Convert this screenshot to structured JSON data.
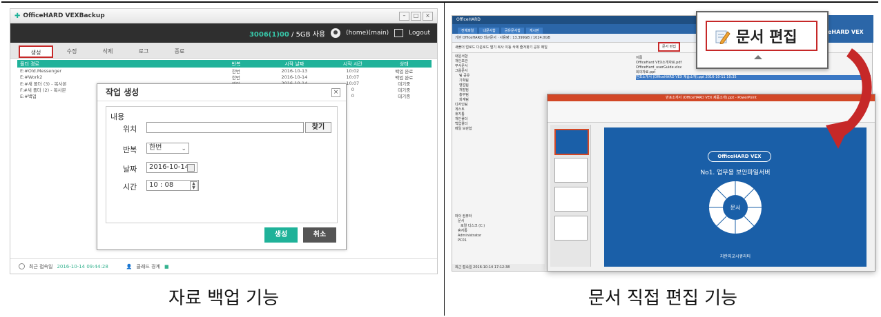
{
  "captions": {
    "left": "자료 백업 기능",
    "right": "문서 직접 편집 기능"
  },
  "left_app": {
    "title": "OfficeHARD VEXBackup",
    "window_buttons": [
      "–",
      "□",
      "×"
    ],
    "header": {
      "usage_used": "3006(1)00",
      "usage_total": "/ 5GB 사용",
      "user": "(home)(main)",
      "logout": "Logout"
    },
    "tabs": [
      {
        "label": "생성",
        "active": true
      },
      {
        "label": "수정",
        "active": false
      },
      {
        "label": "삭제",
        "active": false
      },
      {
        "label": "로그",
        "active": false
      },
      {
        "label": "종료",
        "active": false
      }
    ],
    "grid": {
      "headers": [
        "폴더 경로",
        "반복",
        "시작 날짜",
        "시작 시간",
        "상태"
      ],
      "rows": [
        [
          "E:#Old.Messenger",
          "한번",
          "2016-10-13",
          "10:02",
          "백업 완료"
        ],
        [
          "E:#Work2",
          "한번",
          "2016-10-14",
          "10:07",
          "백업 완료"
        ],
        [
          "E:#새 폴더 (3) - 복사본",
          "매일",
          "2016-10-14",
          "10:07",
          "대기중"
        ],
        [
          "F:#새 폴더 (2) - 복사본",
          "",
          "",
          "0",
          "대기중"
        ],
        [
          "E:#백업",
          "",
          "",
          "0",
          "대기중"
        ]
      ]
    },
    "dialog": {
      "title": "작업 생성",
      "close": "×",
      "section": "내용",
      "location_label": "위치",
      "location_value": "",
      "find_button": "찾기",
      "repeat_label": "반복",
      "repeat_value": "한번",
      "date_label": "날짜",
      "date_value": "2016-10-14",
      "time_label": "시간",
      "time_value": "10 : 08",
      "create_button": "생성",
      "cancel_button": "취소"
    },
    "status": {
      "recent_label": "최근 접속일",
      "recent_time": "2016-10-14 09:44:28",
      "admin_label": "클래드 경계",
      "admin_mark": "■"
    }
  },
  "right_app": {
    "title": "OfficeHARD",
    "menus": [
      "전체파일",
      "내문서함",
      "공유문서함",
      "게시판"
    ],
    "address": "기본 OfficeHARD 최근문서 · 사용량 : 13.399GB / 1024.0GB",
    "toolbar": "새폴더  업로드  다운로드  열기  복사  이동  삭제  즐겨찾기  공유  메일",
    "doc_edit_button": "문서 편집",
    "tree_items": [
      "내문서함",
      "개인보관",
      "부서문서",
      "그룹문서",
      "팀 공유",
      "기획팀",
      "영업팀",
      "개발팀",
      "총무팀",
      "회계팀",
      "디자인팀",
      "게스트",
      "휴지통",
      "개인폴더",
      "백업폴더",
      "메일 보관함"
    ],
    "tree_bottom": [
      "마이 컴퓨터",
      "문서",
      "로컬 디스크 (C:)",
      "휴지통",
      "Administrator",
      "PC01"
    ],
    "files_header": "이름",
    "files": [
      "OfficeHard VEX소개자료.pdf",
      "OfficeHard_userGuide.xlsx",
      "회의자료.ppt",
      "반포소개서 (OfficeHARD VEX 제품소개).ppt  2016-10-11 10:35"
    ],
    "status": "최근 접속일 2016-10-14 17:12:38",
    "callout": {
      "text": "문서 편집",
      "brand": "eHARD VEX"
    },
    "ppt": {
      "title": "반포소개서 (OfficeHARD VEX 제품소개).ppt - PowerPoint",
      "brand": "OfficeHARD VEX",
      "subtitle": "No1. 업무용 보안파일서버",
      "center": "문서",
      "footer": "지란지교시큐리티"
    }
  }
}
